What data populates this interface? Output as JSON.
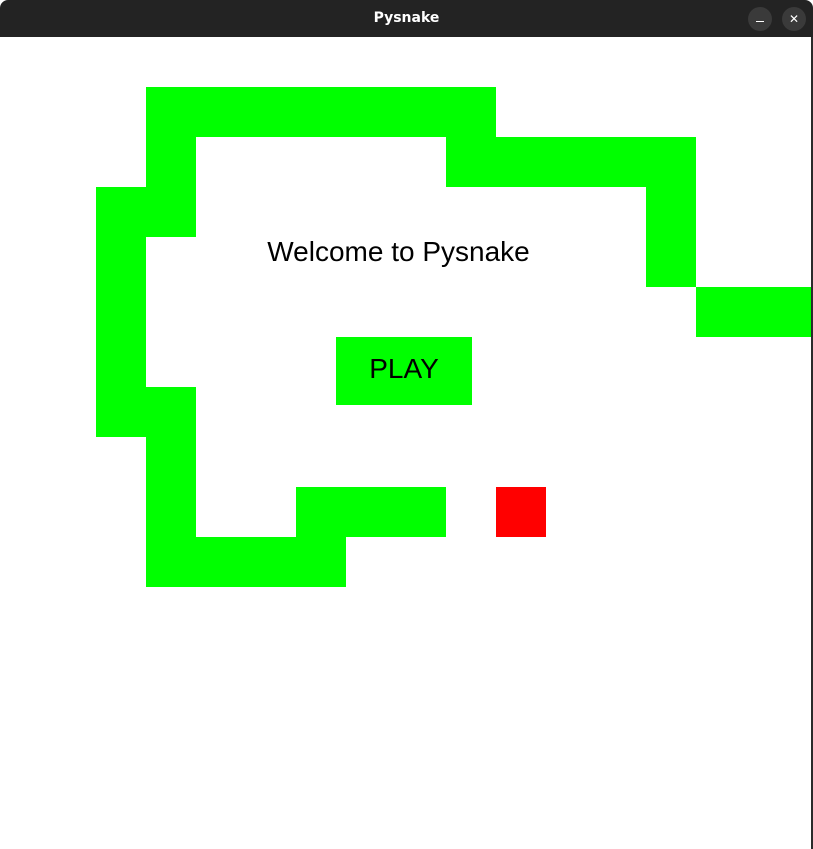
{
  "window": {
    "title": "Pysnake",
    "minimize_label": "–",
    "close_label": "✕"
  },
  "game": {
    "welcome_text": "Welcome to Pysnake",
    "play_label": "PLAY",
    "snake_color": "#00ff00",
    "food_color": "#ff0000",
    "background_color": "#ffffff"
  }
}
